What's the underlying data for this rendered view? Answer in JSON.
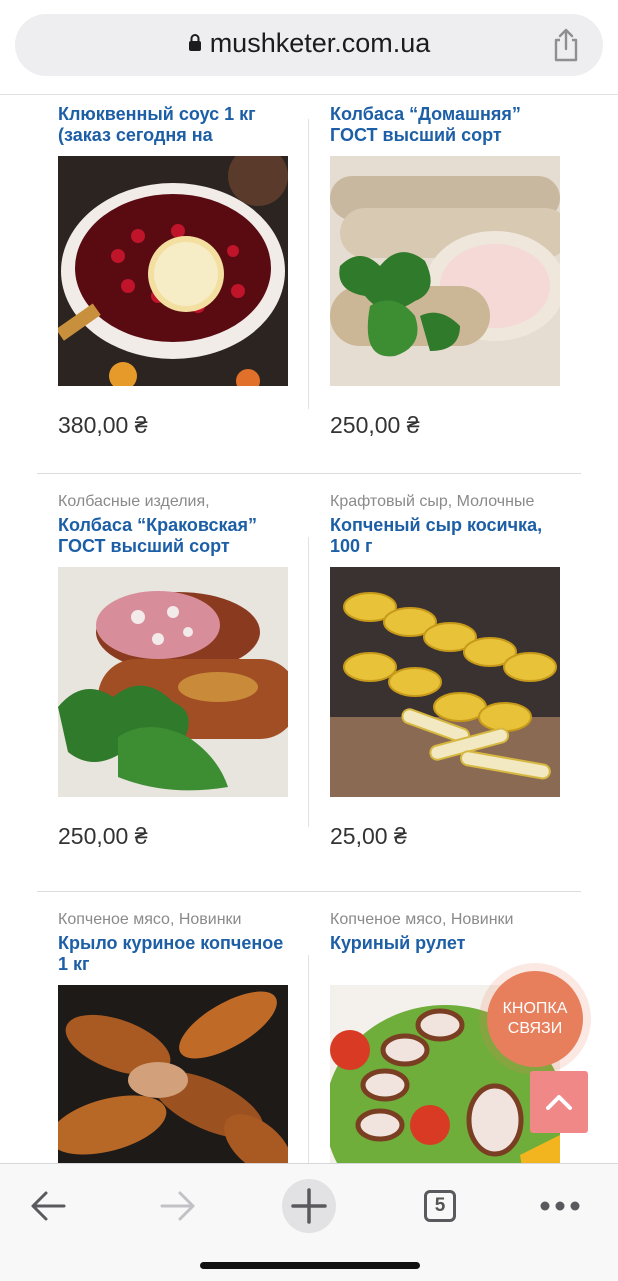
{
  "browser": {
    "url": "mushketer.com.ua",
    "tab_count": "5",
    "icons": {
      "lock": "lock-icon",
      "share": "share-icon",
      "back": "back-arrow-icon",
      "forward": "forward-arrow-icon",
      "new_tab": "plus-icon",
      "tabs": "tabs-icon",
      "more": "more-icon"
    }
  },
  "products": {
    "row1": [
      {
        "category": "",
        "title": "Клюквенный соус 1 кг (заказ сегодня на",
        "price": "380,00 ₴"
      },
      {
        "category": "",
        "title": "Колбаса “Домашняя” ГОСТ высший сорт",
        "price": "250,00 ₴"
      }
    ],
    "row2": [
      {
        "category": "Колбасные изделия,",
        "title": "Колбаса “Краковская” ГОСТ высший сорт",
        "price": "250,00 ₴"
      },
      {
        "category": "Крафтовый сыр, Молочные",
        "title": "Копченый сыр косичка, 100 г",
        "price": "25,00 ₴"
      }
    ],
    "row3": [
      {
        "category": "Копченое мясо, Новинки",
        "title": "Крыло куриное копченое 1 кг",
        "price": ""
      },
      {
        "category": "Копченое мясо, Новинки",
        "title": "Куриный рулет",
        "price": ""
      }
    ]
  },
  "contact_button": {
    "line1": "КНОПКА",
    "line2": "СВЯЗИ"
  },
  "colors": {
    "link": "#1d5fa6",
    "contact": "#e87f5c",
    "scroll_top": "#f08888"
  }
}
